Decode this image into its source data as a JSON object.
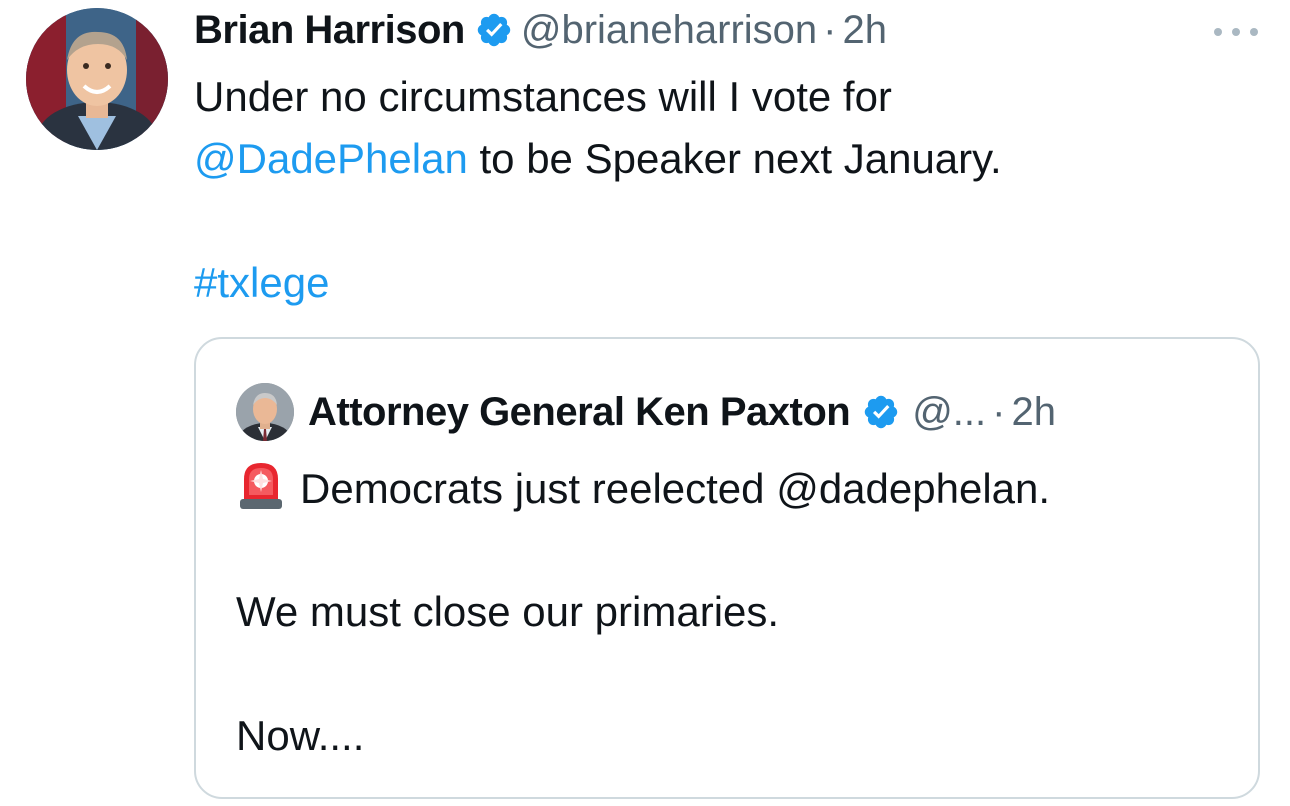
{
  "tweet": {
    "author_name": "Brian Harrison",
    "handle": "@brianeharrison",
    "separator": "·",
    "time": "2h",
    "more_icon": "more-horizontal-icon",
    "verified_icon": "verified-badge-icon",
    "text_line1": "Under no circumstances will I vote for",
    "mention": "@DadePhelan",
    "text_line2_rest": " to be Speaker next January.",
    "hashtag": "#txlege"
  },
  "quoted": {
    "author_name": "Attorney General Ken Paxton",
    "handle": "@...",
    "separator": "·",
    "time": "2h",
    "emoji_icon": "police-siren-icon",
    "line1": "Democrats just reelected @dadephelan.",
    "line2": "We must close our primaries.",
    "line3": "Now...."
  },
  "colors": {
    "link": "#1d9bf0",
    "verified": "#1d9bf0",
    "secondary_text": "#536471",
    "border": "#cfd9de"
  }
}
